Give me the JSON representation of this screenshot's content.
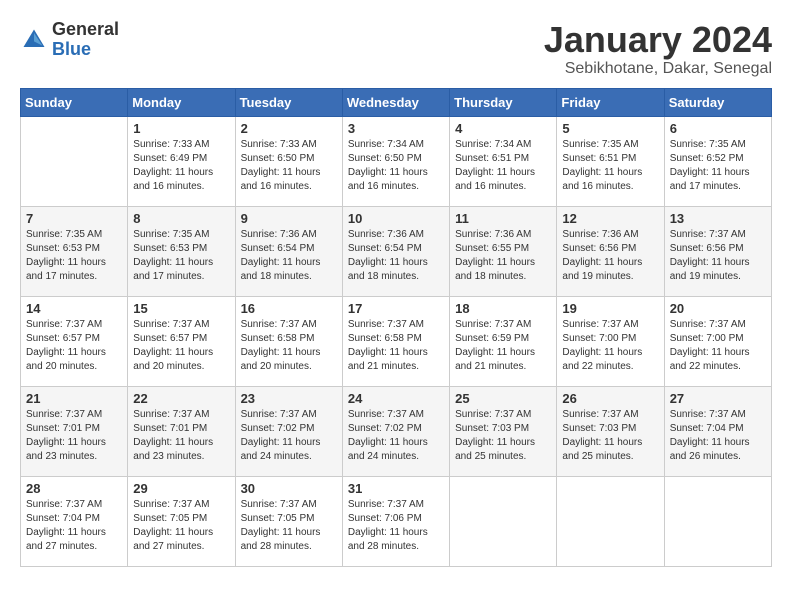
{
  "header": {
    "logo_general": "General",
    "logo_blue": "Blue",
    "title": "January 2024",
    "location": "Sebikhotane, Dakar, Senegal"
  },
  "weekdays": [
    "Sunday",
    "Monday",
    "Tuesday",
    "Wednesday",
    "Thursday",
    "Friday",
    "Saturday"
  ],
  "weeks": [
    [
      {
        "day": "",
        "sunrise": "",
        "sunset": "",
        "daylight": ""
      },
      {
        "day": "1",
        "sunrise": "Sunrise: 7:33 AM",
        "sunset": "Sunset: 6:49 PM",
        "daylight": "Daylight: 11 hours and 16 minutes."
      },
      {
        "day": "2",
        "sunrise": "Sunrise: 7:33 AM",
        "sunset": "Sunset: 6:50 PM",
        "daylight": "Daylight: 11 hours and 16 minutes."
      },
      {
        "day": "3",
        "sunrise": "Sunrise: 7:34 AM",
        "sunset": "Sunset: 6:50 PM",
        "daylight": "Daylight: 11 hours and 16 minutes."
      },
      {
        "day": "4",
        "sunrise": "Sunrise: 7:34 AM",
        "sunset": "Sunset: 6:51 PM",
        "daylight": "Daylight: 11 hours and 16 minutes."
      },
      {
        "day": "5",
        "sunrise": "Sunrise: 7:35 AM",
        "sunset": "Sunset: 6:51 PM",
        "daylight": "Daylight: 11 hours and 16 minutes."
      },
      {
        "day": "6",
        "sunrise": "Sunrise: 7:35 AM",
        "sunset": "Sunset: 6:52 PM",
        "daylight": "Daylight: 11 hours and 17 minutes."
      }
    ],
    [
      {
        "day": "7",
        "sunrise": "Sunrise: 7:35 AM",
        "sunset": "Sunset: 6:53 PM",
        "daylight": "Daylight: 11 hours and 17 minutes."
      },
      {
        "day": "8",
        "sunrise": "Sunrise: 7:35 AM",
        "sunset": "Sunset: 6:53 PM",
        "daylight": "Daylight: 11 hours and 17 minutes."
      },
      {
        "day": "9",
        "sunrise": "Sunrise: 7:36 AM",
        "sunset": "Sunset: 6:54 PM",
        "daylight": "Daylight: 11 hours and 18 minutes."
      },
      {
        "day": "10",
        "sunrise": "Sunrise: 7:36 AM",
        "sunset": "Sunset: 6:54 PM",
        "daylight": "Daylight: 11 hours and 18 minutes."
      },
      {
        "day": "11",
        "sunrise": "Sunrise: 7:36 AM",
        "sunset": "Sunset: 6:55 PM",
        "daylight": "Daylight: 11 hours and 18 minutes."
      },
      {
        "day": "12",
        "sunrise": "Sunrise: 7:36 AM",
        "sunset": "Sunset: 6:56 PM",
        "daylight": "Daylight: 11 hours and 19 minutes."
      },
      {
        "day": "13",
        "sunrise": "Sunrise: 7:37 AM",
        "sunset": "Sunset: 6:56 PM",
        "daylight": "Daylight: 11 hours and 19 minutes."
      }
    ],
    [
      {
        "day": "14",
        "sunrise": "Sunrise: 7:37 AM",
        "sunset": "Sunset: 6:57 PM",
        "daylight": "Daylight: 11 hours and 20 minutes."
      },
      {
        "day": "15",
        "sunrise": "Sunrise: 7:37 AM",
        "sunset": "Sunset: 6:57 PM",
        "daylight": "Daylight: 11 hours and 20 minutes."
      },
      {
        "day": "16",
        "sunrise": "Sunrise: 7:37 AM",
        "sunset": "Sunset: 6:58 PM",
        "daylight": "Daylight: 11 hours and 20 minutes."
      },
      {
        "day": "17",
        "sunrise": "Sunrise: 7:37 AM",
        "sunset": "Sunset: 6:58 PM",
        "daylight": "Daylight: 11 hours and 21 minutes."
      },
      {
        "day": "18",
        "sunrise": "Sunrise: 7:37 AM",
        "sunset": "Sunset: 6:59 PM",
        "daylight": "Daylight: 11 hours and 21 minutes."
      },
      {
        "day": "19",
        "sunrise": "Sunrise: 7:37 AM",
        "sunset": "Sunset: 7:00 PM",
        "daylight": "Daylight: 11 hours and 22 minutes."
      },
      {
        "day": "20",
        "sunrise": "Sunrise: 7:37 AM",
        "sunset": "Sunset: 7:00 PM",
        "daylight": "Daylight: 11 hours and 22 minutes."
      }
    ],
    [
      {
        "day": "21",
        "sunrise": "Sunrise: 7:37 AM",
        "sunset": "Sunset: 7:01 PM",
        "daylight": "Daylight: 11 hours and 23 minutes."
      },
      {
        "day": "22",
        "sunrise": "Sunrise: 7:37 AM",
        "sunset": "Sunset: 7:01 PM",
        "daylight": "Daylight: 11 hours and 23 minutes."
      },
      {
        "day": "23",
        "sunrise": "Sunrise: 7:37 AM",
        "sunset": "Sunset: 7:02 PM",
        "daylight": "Daylight: 11 hours and 24 minutes."
      },
      {
        "day": "24",
        "sunrise": "Sunrise: 7:37 AM",
        "sunset": "Sunset: 7:02 PM",
        "daylight": "Daylight: 11 hours and 24 minutes."
      },
      {
        "day": "25",
        "sunrise": "Sunrise: 7:37 AM",
        "sunset": "Sunset: 7:03 PM",
        "daylight": "Daylight: 11 hours and 25 minutes."
      },
      {
        "day": "26",
        "sunrise": "Sunrise: 7:37 AM",
        "sunset": "Sunset: 7:03 PM",
        "daylight": "Daylight: 11 hours and 25 minutes."
      },
      {
        "day": "27",
        "sunrise": "Sunrise: 7:37 AM",
        "sunset": "Sunset: 7:04 PM",
        "daylight": "Daylight: 11 hours and 26 minutes."
      }
    ],
    [
      {
        "day": "28",
        "sunrise": "Sunrise: 7:37 AM",
        "sunset": "Sunset: 7:04 PM",
        "daylight": "Daylight: 11 hours and 27 minutes."
      },
      {
        "day": "29",
        "sunrise": "Sunrise: 7:37 AM",
        "sunset": "Sunset: 7:05 PM",
        "daylight": "Daylight: 11 hours and 27 minutes."
      },
      {
        "day": "30",
        "sunrise": "Sunrise: 7:37 AM",
        "sunset": "Sunset: 7:05 PM",
        "daylight": "Daylight: 11 hours and 28 minutes."
      },
      {
        "day": "31",
        "sunrise": "Sunrise: 7:37 AM",
        "sunset": "Sunset: 7:06 PM",
        "daylight": "Daylight: 11 hours and 28 minutes."
      },
      {
        "day": "",
        "sunrise": "",
        "sunset": "",
        "daylight": ""
      },
      {
        "day": "",
        "sunrise": "",
        "sunset": "",
        "daylight": ""
      },
      {
        "day": "",
        "sunrise": "",
        "sunset": "",
        "daylight": ""
      }
    ]
  ]
}
